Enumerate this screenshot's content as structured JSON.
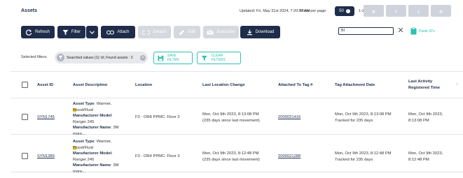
{
  "header": {
    "title": "Assets",
    "updated": "Updated: Fri, May 31st 2024, 7:20:07 AM",
    "rows_per_page_label": "Rows per page:",
    "rows_per_page_value": "50",
    "page_count": "1-2 of 2",
    "pager": [
      "«",
      "‹",
      "›",
      "»"
    ]
  },
  "toolbar": {
    "refresh": "Refresh",
    "filter": "Filter",
    "attach": "Attach",
    "detach": "Detach",
    "edit": "Edit",
    "subscribe": "Subscribe",
    "download": "Download"
  },
  "search": {
    "value": "BI"
  },
  "paste_ids": "Paste ID's",
  "filters": {
    "selected_label": "Selected filters:",
    "chip": "Searched values (1): bl; Found assets : 2",
    "save": "SAVE FILTER",
    "clear": "CLEAR FILTERS"
  },
  "table": {
    "columns": [
      "Asset ID",
      "Asset Description",
      "Location",
      "Last Location Change",
      "Attached To Tag #",
      "Tag Attachment Date",
      "Last Activity",
      "Registered Time"
    ],
    "rows": [
      {
        "asset_id": "SYN1745",
        "desc": {
          "type_label": "Asset Type",
          "type_pre": ": Warmer,",
          "type_hl": "Bl",
          "type_post": "ood/Fluid",
          "model_label": "Manufacturer Model",
          "model_value": "Ranger 245",
          "name_label": "Manufacturer Name",
          "name_value": ": 3M",
          "more": "more..."
        },
        "location": "F3 - OR8 PPMC: Floor 3",
        "last_change": "Mon, Oct 9th 2023, 8:13:08 PM",
        "last_change_note": "(235 days since last movement)",
        "tag": "2000021416",
        "tag_date": "Mon, Oct 9th 2023, 8:13:08 PM",
        "tag_note": "Tracked for 235 days",
        "last_activity": "Mon, Oct 9th 2023,",
        "last_activity_time": "8:13:08 PM"
      },
      {
        "asset_id": "SYN1389",
        "desc": {
          "type_label": "Asset Type",
          "type_pre": ": Warmer,",
          "type_hl": "Bl",
          "type_post": "ood/Fluid",
          "model_label": "Manufacturer Model",
          "model_value": "Ranger 245",
          "name_label": "Manufacturer Name",
          "name_value": ": 3M",
          "more": "more..."
        },
        "location": "F3 - OR4 PPMC: Floor 3",
        "last_change": "Mon, Oct 9th 2023, 8:12:48 PM",
        "last_change_note": "(235 days since last movement)",
        "tag": "2000021288",
        "tag_date": "Mon, Oct 9th 2023, 8:12:48 PM",
        "tag_note": "Tracked for 235 days",
        "last_activity": "Mon, Oct 9th 2023,",
        "last_activity_time": "8:12:48 PM"
      }
    ]
  },
  "colors": {
    "navy": "#1f2d4a",
    "teal": "#2cc0b3",
    "disabled": "#d5d8de",
    "highlight": "#f6d541"
  }
}
